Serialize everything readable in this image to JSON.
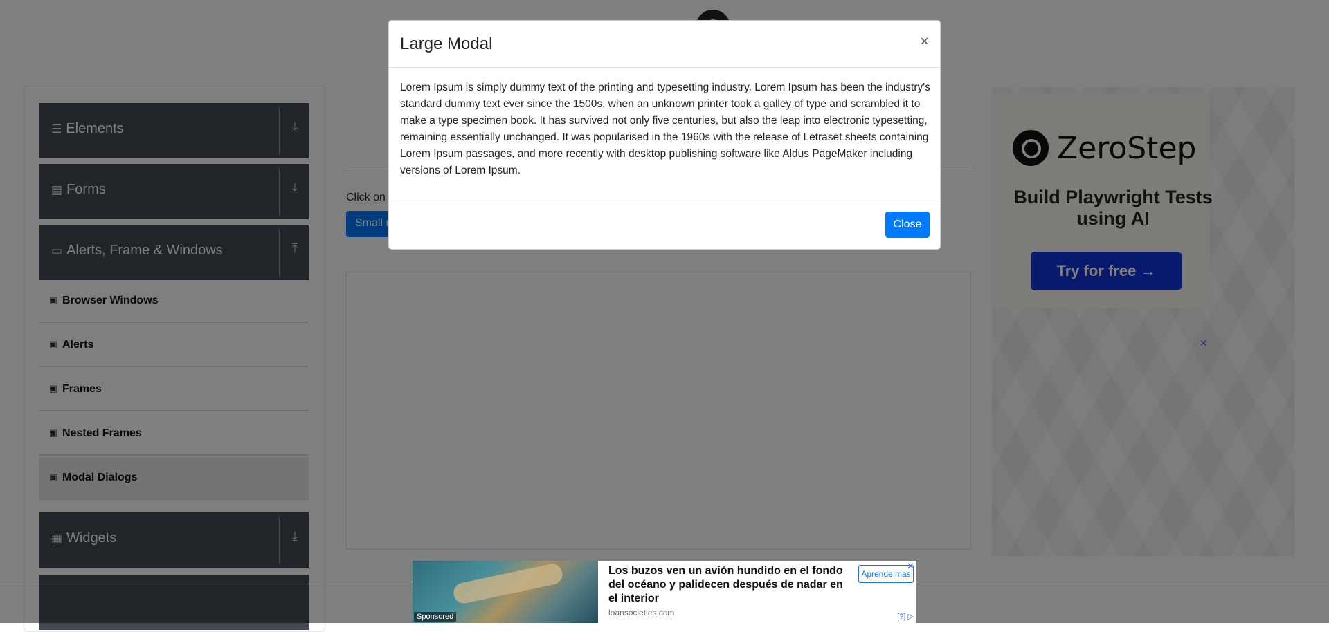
{
  "sidebar": {
    "groups": [
      {
        "label": "Elements",
        "icon": "hamburger-icon",
        "arrow": "download-icon"
      },
      {
        "label": "Forms",
        "icon": "document-icon",
        "arrow": "download-icon"
      },
      {
        "label": "Alerts, Frame & Windows",
        "icon": "window-icon",
        "arrow": "upload-icon"
      },
      {
        "label": "Widgets",
        "icon": "grid-icon",
        "arrow": "download-icon"
      }
    ],
    "items": [
      {
        "label": "Browser Windows"
      },
      {
        "label": "Alerts"
      },
      {
        "label": "Frames"
      },
      {
        "label": "Nested Frames"
      },
      {
        "label": "Modal Dialogs"
      }
    ]
  },
  "main": {
    "instruction": "Click on",
    "small_modal_label": "Small m"
  },
  "modal": {
    "title": "Large Modal",
    "close_symbol": "×",
    "body": "Lorem Ipsum is simply dummy text of the printing and typesetting industry. Lorem Ipsum has been the industry's standard dummy text ever since the 1500s, when an unknown printer took a galley of type and scrambled it to make a type specimen book. It has survived not only five centuries, but also the leap into electronic typesetting, remaining essentially unchanged. It was popularised in the 1960s with the release of Letraset sheets containing Lorem Ipsum passages, and more recently with desktop publishing software like Aldus PageMaker including versions of Lorem Ipsum.",
    "close_label": "Close"
  },
  "right_ad": {
    "brand": "ZeroStep",
    "tagline": "Build Playwright Tests using AI",
    "cta": "Try for free →",
    "close_symbol": "✕"
  },
  "bottom_ad": {
    "headline": "Los buzos ven un avión hundido en el fondo del océano y palidecen después de nadar en el interior",
    "domain": "loansocieties.com",
    "cta": "Aprende mas",
    "sponsored": "Sponsored",
    "info": "[?] ▷",
    "close_symbol": "✕"
  },
  "colors": {
    "accent": "#007bff",
    "sidebar_group_bg": "#434a54",
    "overlay": "rgba(0,0,0,0.5)",
    "zerostep_button": "#1133dd"
  }
}
